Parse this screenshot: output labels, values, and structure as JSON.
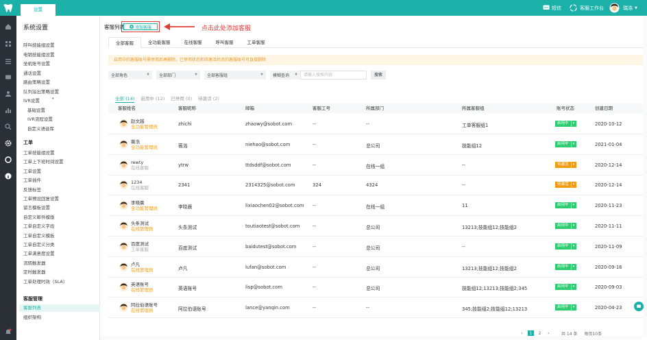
{
  "topbar": {
    "tab": "设置",
    "sms": "短信",
    "workbench": "客服工作台",
    "user": "瑞浩"
  },
  "sidebar": {
    "title": "系统设置",
    "items": [
      "呼叫技能组设置",
      "电销技能组设置",
      "坐机账号设置",
      "通话设置",
      "路由策略设置",
      "队列溢出策略设置",
      "IVR设置"
    ],
    "ivr_sub": [
      "基础设置",
      "IVR流程设置",
      "自定义语音库"
    ],
    "ticket_head": "工单",
    "ticket_items": [
      "工单技能组设置",
      "工单上下班时间设置",
      "工单设置",
      "工单插件",
      "反馈标签",
      "工单预设回复设置",
      "留言模板设置",
      "自定义邮件模版",
      "工单自定义字段",
      "工单自定义模板",
      "工单自定义分类",
      "工单满意度设置",
      "流转触发器",
      "定时触发器",
      "工单处理时效（SLA）"
    ],
    "customer_head": "客服管理",
    "customer_items": [
      "客服列表",
      "组织架构"
    ]
  },
  "main": {
    "title": "客服列表",
    "add_button": "添加客服",
    "annotation": "点击此处添加客服",
    "tabs": [
      "全部客服",
      "全功能客服",
      "在线客服",
      "呼叫客服",
      "工单客服"
    ],
    "notice": "启用中的客服账号需停用后再删除，已停用状态和待激活状态的客服账号可直接删除",
    "filters": {
      "role": "全部角色",
      "dept": "全部部门",
      "group": "全部客服组",
      "mode": "模糊查询",
      "placeholder": "请输入搜索内容",
      "search": "搜索"
    },
    "subtabs": [
      "全部 (14)",
      "启用中 (12)",
      "已停用 (0)",
      "待激活 (2)"
    ],
    "columns": [
      "客服姓名",
      "客服昵称",
      "邮箱",
      "客服工号",
      "所属部门",
      "所属客服组",
      "账号状态",
      "创建日期"
    ],
    "rows": [
      {
        "name": "赵文越",
        "role": "全功能管理员",
        "nick": "zhichi",
        "email": "zhaowy@sobot.com",
        "no": "--",
        "dept": "--",
        "group": "工单客服组1",
        "status": "启用中",
        "date": "2020-10-12",
        "muted": false,
        "orange": false
      },
      {
        "name": "薇浩",
        "role": "全功能管理员",
        "nick": "薇浩",
        "email": "niehao@sobot.com",
        "no": "--",
        "dept": "总公司",
        "group": "技能组12",
        "status": "启用中",
        "date": "2021-01-04",
        "muted": false,
        "orange": false
      },
      {
        "name": "rewty",
        "role": "在线客服",
        "nick": "ytrw",
        "email": "ttdsddf@sobot.com",
        "no": "--",
        "dept": "在线一组",
        "group": "--",
        "status": "待激活",
        "date": "2020-12-14",
        "muted": true,
        "orange": true
      },
      {
        "name": "1234",
        "role": "在线客服",
        "nick": "2341",
        "email": "2314325@sobot.com",
        "no": "324",
        "dept": "4324",
        "group": "--",
        "status": "待激活",
        "date": "2020-12-14",
        "muted": true,
        "orange": true
      },
      {
        "name": "李晓晨",
        "role": "全功能管理员",
        "nick": "李晓晨",
        "email": "lixiaochen02@sobot.com",
        "no": "--",
        "dept": "在线一组",
        "group": "11",
        "status": "启用中",
        "date": "2020-11-23",
        "muted": false,
        "orange": false
      },
      {
        "name": "头条测试",
        "role": "在线管理员",
        "nick": "头条测试",
        "email": "toutiaotest@sobot.com",
        "no": "--",
        "dept": "总公司",
        "group": "13213;技能组12;技能组2",
        "status": "启用中",
        "date": "2020-11-11",
        "muted": false,
        "orange": false
      },
      {
        "name": "百度测试",
        "role": "工单客服",
        "nick": "百度测试",
        "email": "baidutest@sobot.com",
        "no": "--",
        "dept": "总公司",
        "group": "--",
        "status": "启用中",
        "date": "2020-11-09",
        "muted": true,
        "orange": false
      },
      {
        "name": "卢凡",
        "role": "在线管理员",
        "nick": "卢凡",
        "email": "lufan@sobot.com",
        "no": "--",
        "dept": "总公司",
        "group": "13213;技能组12;技能组2",
        "status": "启用中",
        "date": "2020-09-16",
        "muted": false,
        "orange": false
      },
      {
        "name": "英语账号",
        "role": "在线管理员",
        "nick": "英语账号",
        "email": "lisp@sobot.com",
        "no": "--",
        "dept": "总公司",
        "group": "技能组12;13213;技能组2;345",
        "status": "启用中",
        "date": "2020-09-03",
        "muted": false,
        "orange": false
      },
      {
        "name": "阿拉伯语账号",
        "role": "在线管理员",
        "nick": "阿拉伯语账号",
        "email": "lance@yanqin.com",
        "no": "--",
        "dept": "--",
        "group": "345;技能组2;技能组12;13213",
        "status": "启用中",
        "date": "2020-04-23",
        "muted": false,
        "orange": false
      }
    ],
    "pager": {
      "pages": [
        "1",
        "2"
      ],
      "total": "共 14 条",
      "size": "每页10条"
    }
  }
}
